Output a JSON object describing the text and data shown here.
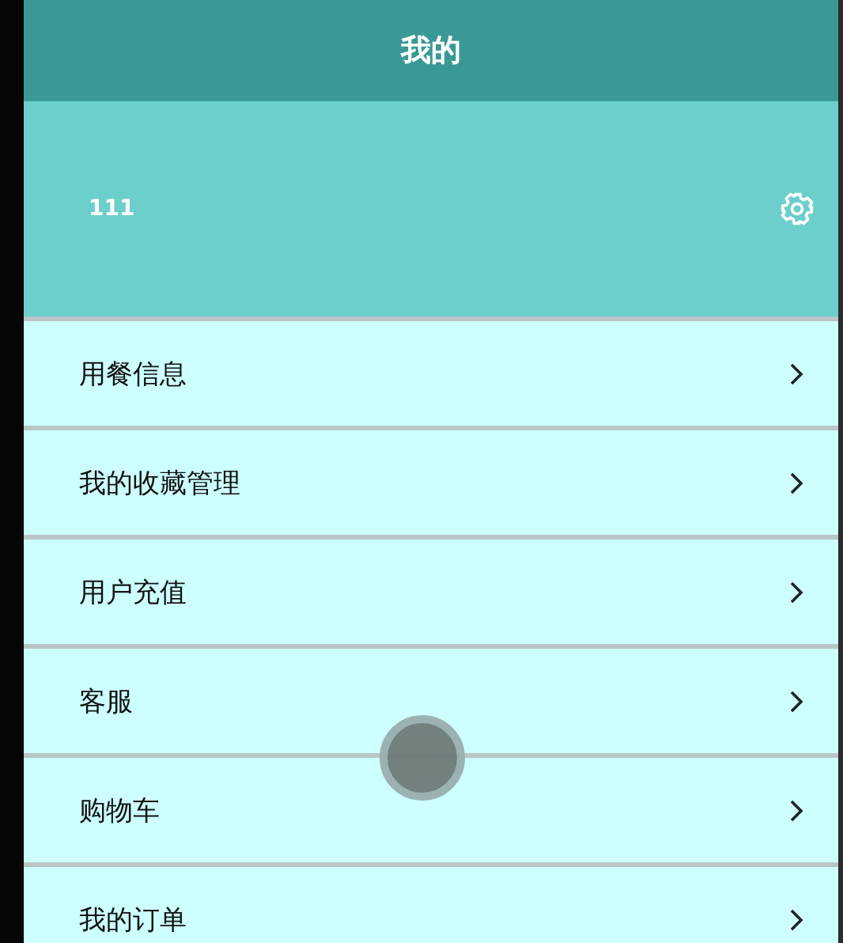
{
  "header": {
    "title": "我的"
  },
  "profile": {
    "username": "111"
  },
  "menu_items": [
    {
      "label": "用餐信息"
    },
    {
      "label": "我的收藏管理"
    },
    {
      "label": "用户充值"
    },
    {
      "label": "客服"
    },
    {
      "label": "购物车"
    },
    {
      "label": "我的订单"
    }
  ]
}
